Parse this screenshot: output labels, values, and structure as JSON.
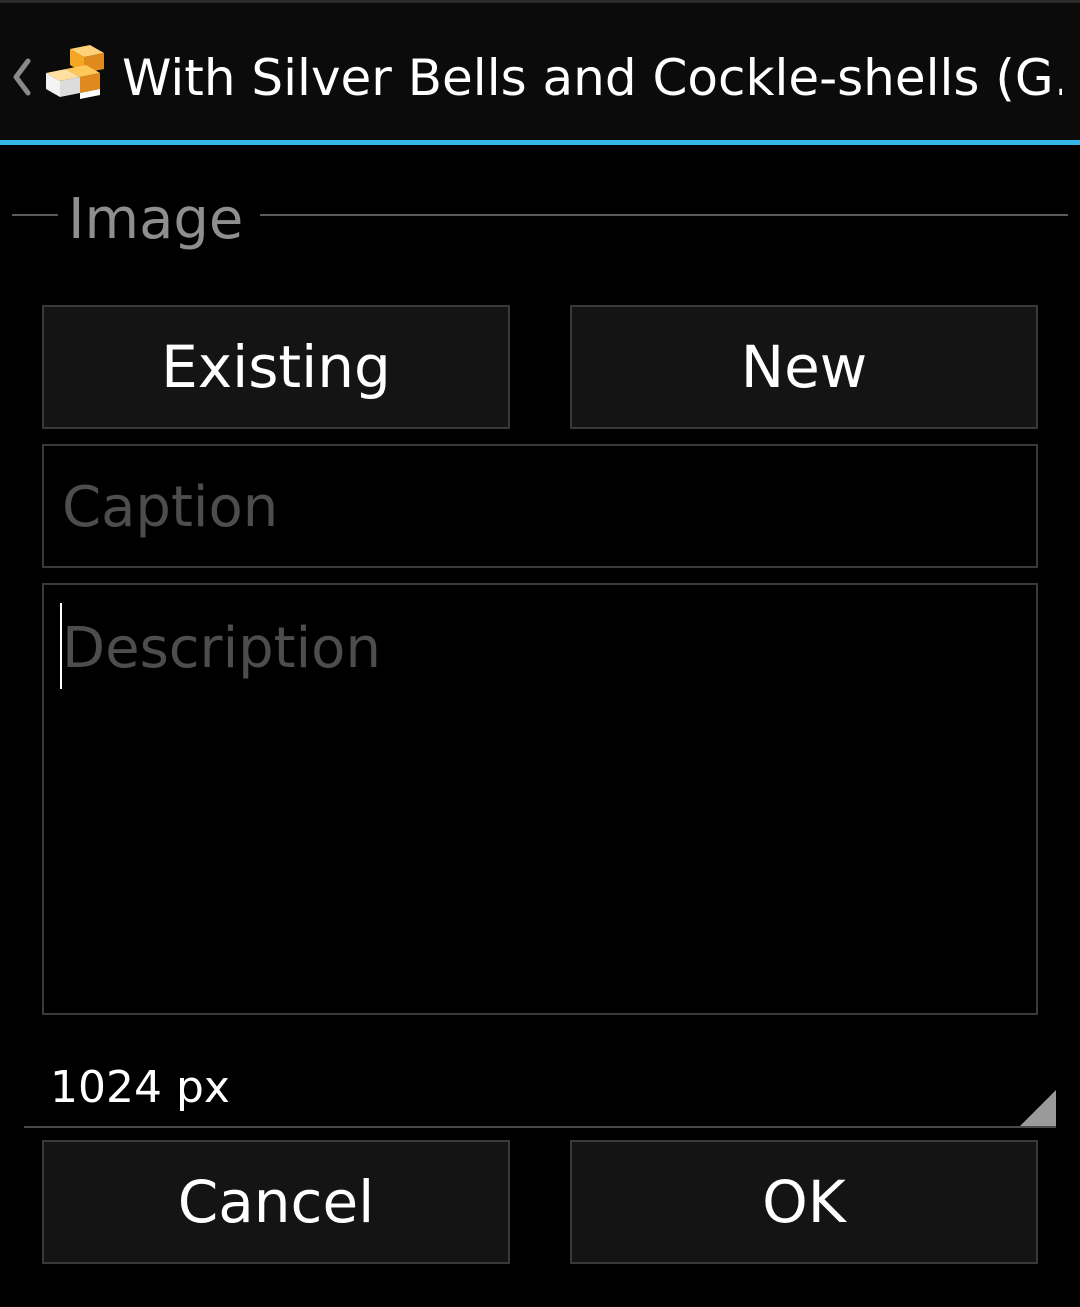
{
  "action_bar": {
    "title": "With Silver Bells and Cockle-shells (G…",
    "up_icon": "chevron-left-icon",
    "app_icon": "app-logo-icon",
    "accent_color": "#33b5e5"
  },
  "section": {
    "title": "Image"
  },
  "image_source": {
    "existing_label": "Existing",
    "new_label": "New"
  },
  "caption": {
    "value": "",
    "placeholder": "Caption"
  },
  "description": {
    "value": "",
    "placeholder": "Description"
  },
  "size": {
    "selected": "1024 px"
  },
  "dialog_buttons": {
    "cancel_label": "Cancel",
    "ok_label": "OK"
  }
}
